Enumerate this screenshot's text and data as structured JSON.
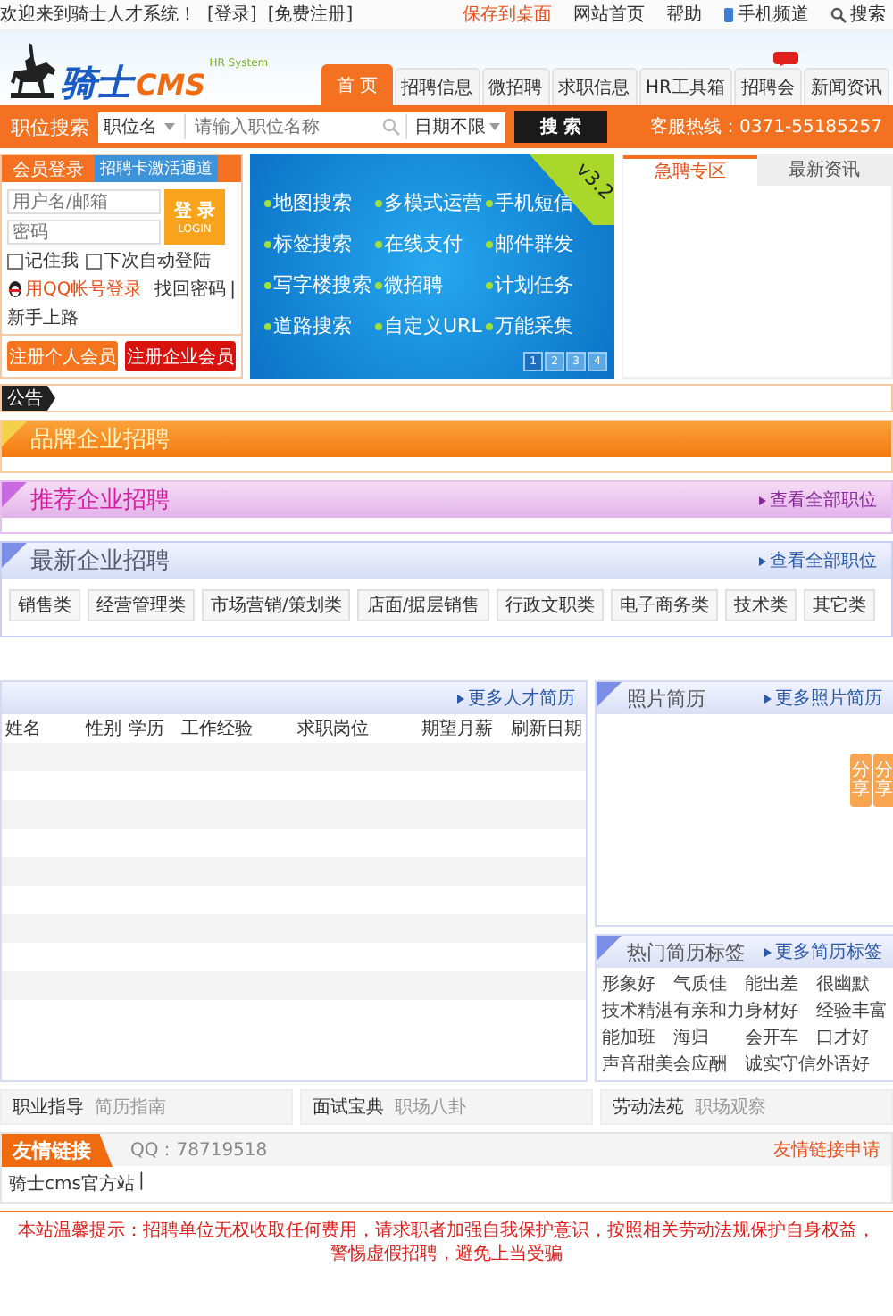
{
  "top_bar": {
    "welcome": "欢迎来到骑士人才系统！",
    "links": [
      "[登录]",
      "[免费注册]"
    ],
    "right_links": [
      {
        "text": "保存到桌面",
        "kind": "highlight"
      },
      {
        "text": "网站首页",
        "kind": "plain"
      },
      {
        "text": "帮助",
        "kind": "plain"
      },
      {
        "text": "手机频道",
        "kind": "phone"
      },
      {
        "text": "搜索",
        "kind": "search"
      }
    ]
  },
  "logo": {
    "name": "骑士",
    "suffix": "CMS",
    "tagline": "HR System"
  },
  "nav": [
    {
      "label": "首 页",
      "selected": true,
      "new": false
    },
    {
      "label": "招聘信息",
      "selected": false,
      "new": false
    },
    {
      "label": "微招聘",
      "selected": false,
      "new": false
    },
    {
      "label": "求职信息",
      "selected": false,
      "new": false
    },
    {
      "label": "HR工具箱",
      "selected": false,
      "new": false
    },
    {
      "label": "招聘会",
      "selected": false,
      "new": true
    },
    {
      "label": "新闻资讯",
      "selected": false,
      "new": false
    }
  ],
  "search": {
    "label": "职位搜索",
    "field_type": "职位名",
    "placeholder": "请输入职位名称",
    "date": "日期不限",
    "button": "搜 索",
    "hotline": "客服热线：0371-55185257"
  },
  "login": {
    "tab": "会员登录",
    "activate": "招聘卡激活通道",
    "user_placeholder": "用户名/邮箱",
    "password_placeholder": "密码",
    "login_button": "登 录",
    "login_sub": "LOGIN",
    "options": [
      {
        "label": "记住我",
        "checked": false
      },
      {
        "label": "下次自动登陆",
        "checked": false
      }
    ],
    "qq": "用QQ帐号登录",
    "links": [
      "找回密码",
      "新手上路"
    ],
    "separator": "|",
    "register": [
      "注册个人会员",
      "注册企业会员"
    ]
  },
  "banner": {
    "version": "v3.2",
    "features": [
      "地图搜索",
      "多模式运营",
      "手机短信",
      "标签搜索",
      "在线支付",
      "邮件群发",
      "写字楼搜索",
      "微招聘",
      "计划任务",
      "道路搜索",
      "自定义URL",
      "万能采集"
    ],
    "pages": [
      {
        "label": "1",
        "selected": true
      },
      {
        "label": "2",
        "selected": false
      },
      {
        "label": "3",
        "selected": false
      },
      {
        "label": "4",
        "selected": false
      }
    ]
  },
  "news_tabs": [
    {
      "label": "急聘专区",
      "selected": true
    },
    {
      "label": "最新资讯",
      "selected": false
    }
  ],
  "notice": {
    "label": "公告"
  },
  "sections": [
    {
      "title": "品牌企业招聘",
      "kind": "orange"
    },
    {
      "title": "推荐企业招聘",
      "kind": "pink",
      "more": "查看全部职位"
    },
    {
      "title": "最新企业招聘",
      "kind": "blue",
      "more": "查看全部职位",
      "tags": [
        "销售类",
        "经营管理类",
        "市场营销/策划类",
        "店面/据层销售",
        "行政文职类",
        "电子商务类",
        "技术类",
        "其它类"
      ]
    }
  ],
  "resumes": {
    "more": "更多人才简历",
    "columns": [
      "姓名",
      "性别",
      "学历",
      "工作经验",
      "求职岗位",
      "期望月薪",
      "刷新日期"
    ]
  },
  "photo_resumes": {
    "title": "照片简历",
    "more": "更多照片简历"
  },
  "share": [
    "分享",
    "分享"
  ],
  "hot_tags": {
    "title": "热门简历标签",
    "more": "更多简历标签",
    "tags": [
      "形象好",
      "气质佳",
      "能出差",
      "很幽默",
      "技术精湛",
      "有亲和力",
      "身材好",
      "经验丰富",
      "能加班",
      "海归",
      "会开车",
      "口才好",
      "声音甜美",
      "会应酬",
      "诚实守信",
      "外语好"
    ]
  },
  "guides": [
    {
      "title": "职业指导",
      "link": "简历指南"
    },
    {
      "title": "面试宝典",
      "link": "职场八卦"
    },
    {
      "title": "劳动法苑",
      "link": "职场观察"
    }
  ],
  "friend_links": {
    "title": "友情链接",
    "qq": "QQ：78719518",
    "apply": "友情链接申请",
    "links": [
      "骑士cms官方站"
    ],
    "separator": "|"
  },
  "footer": {
    "notice": "本站温馨提示：招聘单位无权收取任何费用，请求职者加强自我保护意识，按照相关劳动法规保护自身权益，警惕虚假招聘，避免上当受骗"
  }
}
